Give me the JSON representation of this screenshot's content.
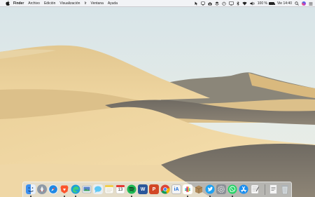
{
  "menubar": {
    "apple_icon": "apple-logo-icon",
    "app_name": "Finder",
    "items": [
      "Archivo",
      "Edición",
      "Visualización",
      "Ir",
      "Ventana",
      "Ayuda"
    ],
    "status": {
      "icons": [
        "pointer-icon",
        "airplay-icon",
        "camera-icon",
        "stack-icon",
        "timer-icon",
        "screen-mirroring-icon",
        "bluetooth-icon",
        "wifi-icon",
        "volume-icon"
      ],
      "battery_text": "100 %",
      "battery_level": 1.0,
      "clock": "Vie 14:40",
      "search_icon": "spotlight-search-icon",
      "siri_icon": "siri-icon"
    }
  },
  "desktop": {
    "wallpaper": "Mojave day sand dunes"
  },
  "dock": {
    "apps": [
      {
        "name": "finder",
        "icon": "finder-icon",
        "color": "#3b8ff0",
        "running": true
      },
      {
        "name": "launchpad",
        "icon": "launchpad-rocket-icon",
        "color": "#9aa7b3",
        "running": false
      },
      {
        "name": "safari",
        "icon": "safari-compass-icon",
        "color": "#1e88e5",
        "running": false
      },
      {
        "name": "brave",
        "icon": "brave-lion-icon",
        "color": "#fb542b",
        "running": true
      },
      {
        "name": "edge",
        "icon": "edge-icon",
        "color": "#1c9fd8",
        "running": true
      },
      {
        "name": "preview",
        "icon": "preview-photos-icon",
        "color": "#5a83c9",
        "running": false
      },
      {
        "name": "messages",
        "icon": "messages-bubble-icon",
        "color": "#5cc7f5",
        "running": false
      },
      {
        "name": "notes",
        "icon": "notes-icon",
        "color": "#f5f5f0",
        "running": false
      },
      {
        "name": "calendar",
        "icon": "calendar-icon",
        "color": "#ffffff",
        "running": false,
        "label": "13"
      },
      {
        "name": "spotify",
        "icon": "spotify-icon",
        "color": "#1db954",
        "running": true
      },
      {
        "name": "word",
        "icon": "word-icon",
        "color": "#2b579a",
        "running": false,
        "label": "W"
      },
      {
        "name": "powerpoint",
        "icon": "powerpoint-icon",
        "color": "#d24726",
        "running": false,
        "label": "P"
      },
      {
        "name": "chrome",
        "icon": "chrome-icon",
        "color": "#db4437",
        "running": false
      },
      {
        "name": "iawriter",
        "icon": "ia-writer-icon",
        "color": "#f4f4f4",
        "running": false,
        "label": "iA"
      },
      {
        "name": "slack",
        "icon": "slack-icon",
        "color": "#ffffff",
        "running": true
      },
      {
        "name": "archive-utility",
        "icon": "archive-box-icon",
        "color": "#9b7b55",
        "running": false
      },
      {
        "name": "tweetbot",
        "icon": "twitter-bird-icon",
        "color": "#1da1f2",
        "running": true
      },
      {
        "name": "system-preferences",
        "icon": "gear-icon",
        "color": "#8a8f96",
        "running": false
      },
      {
        "name": "whatsapp",
        "icon": "whatsapp-icon",
        "color": "#25d366",
        "running": true
      },
      {
        "name": "app-store",
        "icon": "app-store-icon",
        "color": "#1c8ff0",
        "running": false
      },
      {
        "name": "textedit",
        "icon": "textedit-icon",
        "color": "#f2f2f2",
        "running": false
      }
    ],
    "documents_icon": "documents-stack-icon",
    "trash_icon": "trash-icon"
  }
}
